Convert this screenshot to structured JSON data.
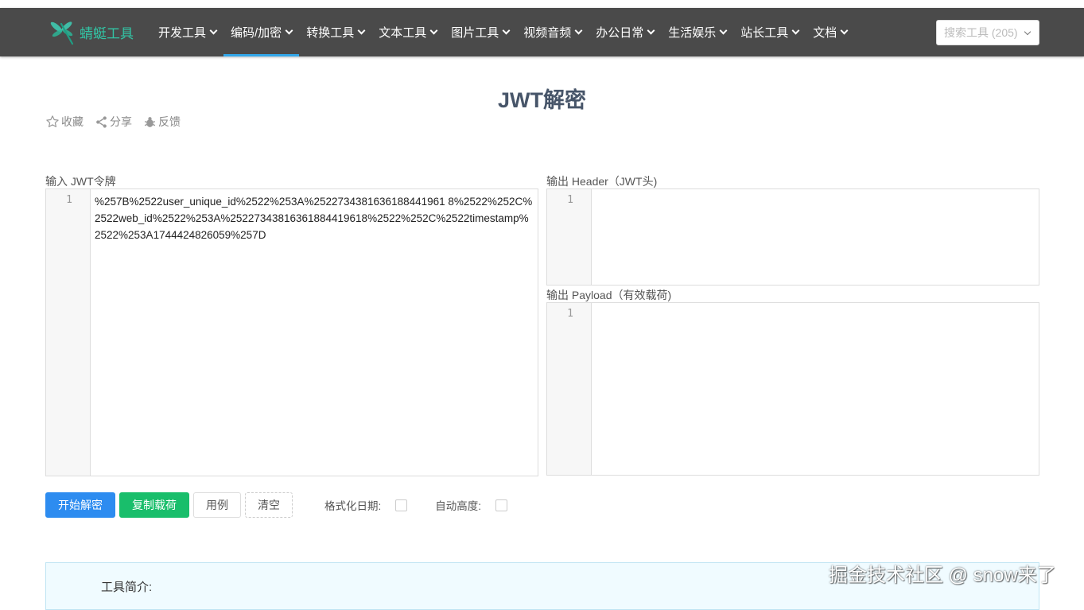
{
  "header": {
    "brand": "蜻蜓工具",
    "nav": [
      {
        "label": "开发工具",
        "active": false
      },
      {
        "label": "编码/加密",
        "active": true
      },
      {
        "label": "转换工具",
        "active": false
      },
      {
        "label": "文本工具",
        "active": false
      },
      {
        "label": "图片工具",
        "active": false
      },
      {
        "label": "视频音频",
        "active": false
      },
      {
        "label": "办公日常",
        "active": false
      },
      {
        "label": "生活娱乐",
        "active": false
      },
      {
        "label": "站长工具",
        "active": false
      },
      {
        "label": "文档",
        "active": false
      }
    ],
    "search_placeholder": "搜索工具 (205)"
  },
  "page": {
    "title": "JWT解密",
    "actions": {
      "favorite": "收藏",
      "share": "分享",
      "feedback": "反馈"
    }
  },
  "input": {
    "label": "输入 JWT令牌",
    "line_number": "1",
    "value": "%257B%2522user_unique_id%2522%253A%2522734381636188441961 8%2522%252C%2522web_id%2522%253A%25227343816361884419618%2522%252C%2522timestamp%2522%253A1744424826059%257D"
  },
  "output_header": {
    "label": "输出 Header（JWT头)",
    "line_number": "1",
    "value": ""
  },
  "output_payload": {
    "label": "输出 Payload（有效载荷)",
    "line_number": "1",
    "value": ""
  },
  "buttons": {
    "decode": "开始解密",
    "copy_payload": "复制载荷",
    "example": "用例",
    "clear": "清空"
  },
  "options": {
    "format_date": "格式化日期:",
    "format_date_checked": false,
    "auto_height": "自动高度:",
    "auto_height_checked": false
  },
  "intro": {
    "title": "工具简介:"
  },
  "watermark": "掘金技术社区 @ snow来了",
  "colors": {
    "navbar": "#4a4a4a",
    "brand": "#32c5a5",
    "active_underline": "#32a6e8",
    "primary": "#2d8cf0",
    "success": "#19be6b"
  }
}
